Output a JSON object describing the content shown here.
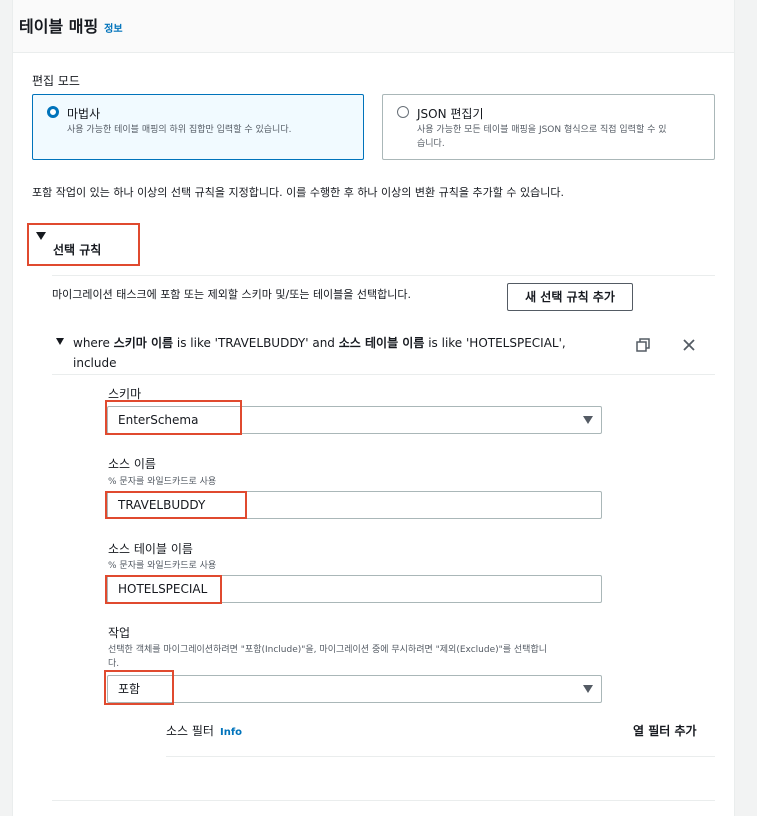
{
  "header": {
    "title": "테이블 매핑",
    "info_link": "정보"
  },
  "edit_mode": {
    "label": "편집 모드",
    "options": [
      {
        "title": "마법사",
        "desc": "사용 가능한 테이블 매핑의 하위 집합만 입력할 수 있습니다.",
        "selected": true
      },
      {
        "title": "JSON 편집기",
        "desc_line1": "사용 가능한 모든 테이블 매핑을 JSON 형식으로 직접 입력할 수 있",
        "desc_line2": "습니다.",
        "selected": false
      }
    ]
  },
  "intro_text": "포함 작업이 있는 하나 이상의 선택 규칙을 지정합니다. 이를 수행한 후 하나 이상의 변환 규칙을 추가할 수 있습니다.",
  "selection_rules": {
    "title": "선택 규칙",
    "description": "마이그레이션 태스크에 포함 또는 제외할 스키마 및/또는 테이블을 선택합니다.",
    "add_button": "새 선택 규칙 추가",
    "rule": {
      "summary_w1": "where ",
      "summary_b1": "스키마 이름",
      "summary_w2": " is like 'TRAVELBUDDY' and ",
      "summary_b2": "소스 테이블 이름",
      "summary_w3": " is like 'HOTELSPECIAL',",
      "summary_line2": "include",
      "schema": {
        "label": "스키마",
        "value": "EnterSchema"
      },
      "source_name": {
        "label": "소스 이름",
        "hint": "% 문자를 와일드카드로 사용",
        "value": "TRAVELBUDDY"
      },
      "source_table": {
        "label": "소스 테이블 이름",
        "hint": "% 문자를 와일드카드로 사용",
        "value": "HOTELSPECIAL"
      },
      "action": {
        "label": "작업",
        "hint_line1": "선택한 객체를 마이그레이션하려면 \"포함(Include)\"을, 마이그레이션 중에 무시하려면 \"제외(Exclude)\"를 선택합니",
        "hint_line2": "다.",
        "value": "포함"
      },
      "source_filter": {
        "label": "소스 필터",
        "info": "Info",
        "add_column_filter": "열 필터 추가"
      }
    }
  },
  "colors": {
    "accent": "#0073bb",
    "highlight": "#e04a2f"
  }
}
